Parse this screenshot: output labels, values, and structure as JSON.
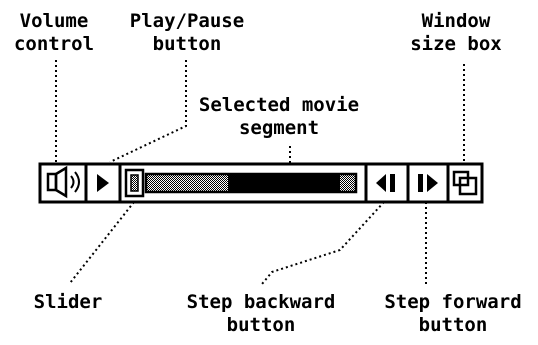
{
  "labels": {
    "volume_control": [
      "Volume",
      "control"
    ],
    "play_pause": [
      "Play/Pause",
      "button"
    ],
    "window_size_box": [
      "Window",
      "size box"
    ],
    "selected_segment": [
      "Selected movie",
      "segment"
    ],
    "slider": [
      "Slider"
    ],
    "step_backward": [
      "Step backward",
      "button"
    ],
    "step_forward": [
      "Step forward",
      "button"
    ]
  },
  "icons": {
    "volume": "speaker-icon",
    "play": "play-triangle-icon",
    "slider_thumb": "slider-thumb-icon",
    "step_backward": "step-backward-icon",
    "step_forward": "step-forward-icon",
    "size_box": "window-size-box-icon"
  },
  "colors": {
    "foreground": "#000000",
    "background": "#ffffff"
  }
}
